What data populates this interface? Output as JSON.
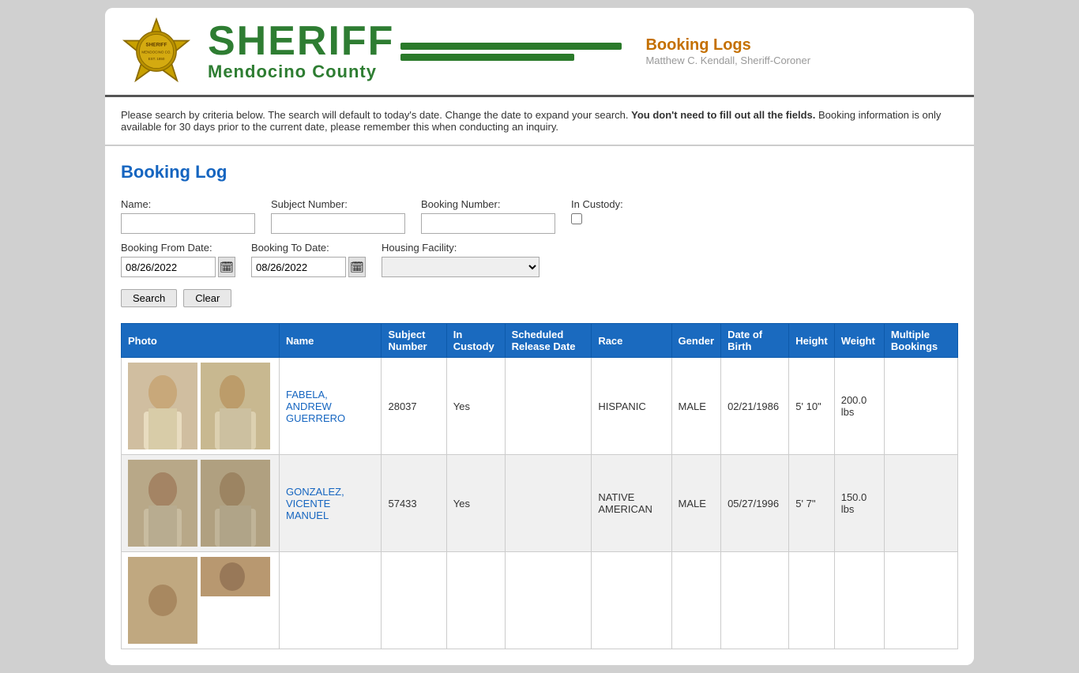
{
  "header": {
    "title": "SHERIFF",
    "subtitle": "Mendocino County",
    "section": "Booking Logs",
    "sheriff_name": "Matthew C. Kendall, Sheriff-Coroner"
  },
  "info_text": "Please search by criteria below. The search will default to today's date. Change the date to expand your search.",
  "info_bold": "You don't need to fill out all the fields.",
  "info_text2": "Booking information is only available for 30 days prior to the current date, please remember this when conducting an inquiry.",
  "page_title": "Booking Log",
  "form": {
    "name_label": "Name:",
    "subject_number_label": "Subject Number:",
    "booking_number_label": "Booking Number:",
    "in_custody_label": "In Custody:",
    "booking_from_label": "Booking From Date:",
    "booking_to_label": "Booking To Date:",
    "housing_facility_label": "Housing Facility:",
    "booking_from_value": "08/26/2022",
    "booking_to_value": "08/26/2022",
    "search_button": "Search",
    "clear_button": "Clear"
  },
  "table": {
    "columns": [
      "Photo",
      "Name",
      "Subject Number",
      "In Custody",
      "Scheduled Release Date",
      "Race",
      "Gender",
      "Date of Birth",
      "Height",
      "Weight",
      "Multiple Bookings"
    ],
    "rows": [
      {
        "name": "FABELA, ANDREW GUERRERO",
        "subject_number": "28037",
        "in_custody": "Yes",
        "scheduled_release": "",
        "race": "HISPANIC",
        "gender": "MALE",
        "dob": "02/21/1986",
        "height": "5' 10\"",
        "weight": "200.0 lbs",
        "multiple_bookings": ""
      },
      {
        "name": "GONZALEZ, VICENTE MANUEL",
        "subject_number": "57433",
        "in_custody": "Yes",
        "scheduled_release": "",
        "race": "NATIVE AMERICAN",
        "gender": "MALE",
        "dob": "05/27/1996",
        "height": "5' 7\"",
        "weight": "150.0 lbs",
        "multiple_bookings": ""
      },
      {
        "name": "",
        "subject_number": "",
        "in_custody": "",
        "scheduled_release": "",
        "race": "",
        "gender": "",
        "dob": "",
        "height": "",
        "weight": "",
        "multiple_bookings": ""
      }
    ]
  }
}
